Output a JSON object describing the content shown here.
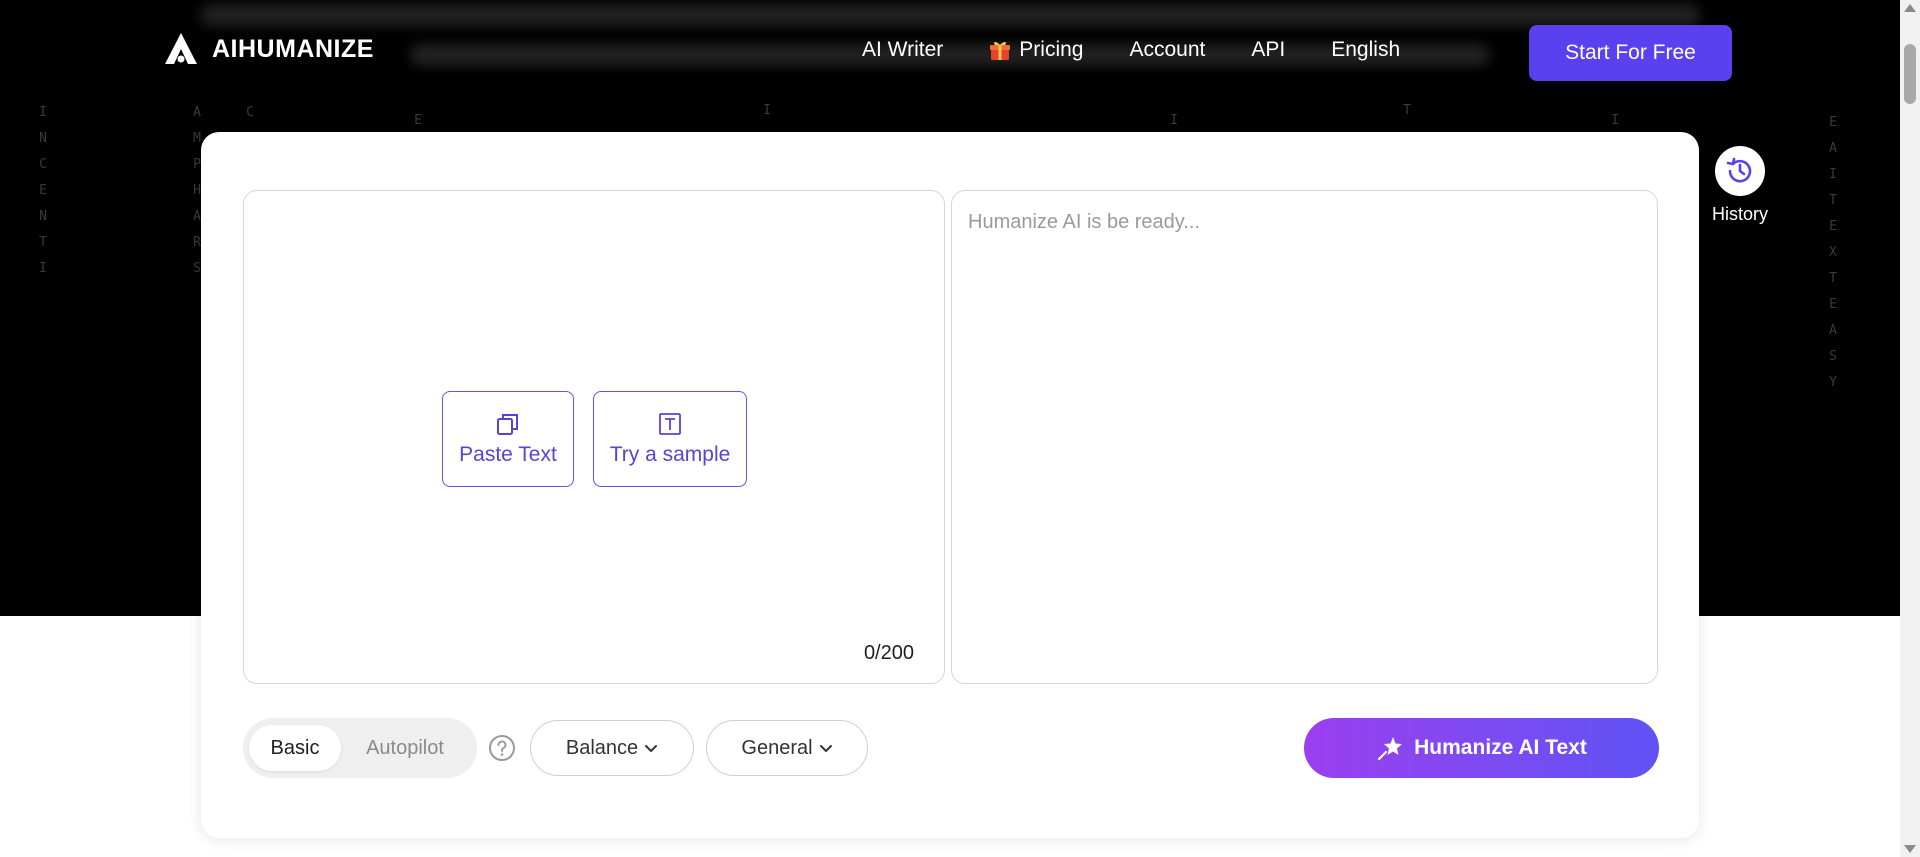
{
  "brand": {
    "name": "AIHUMANIZE",
    "accent": "#5a41f0",
    "background": "#000000"
  },
  "nav": {
    "items": [
      {
        "label": "AI Writer",
        "icon": ""
      },
      {
        "label": "Pricing",
        "icon": "gift-icon"
      },
      {
        "label": "Account",
        "icon": ""
      },
      {
        "label": "API",
        "icon": ""
      },
      {
        "label": "English",
        "icon": ""
      }
    ],
    "cta": "Start For Free"
  },
  "history": {
    "label": "History",
    "icon": "history-icon"
  },
  "editor": {
    "paste_label": "Paste Text",
    "sample_label": "Try a sample",
    "counter": "0/200",
    "output_placeholder": "Humanize AI is be ready..."
  },
  "controls": {
    "modes": [
      "Basic",
      "Autopilot"
    ],
    "active_mode": "Basic",
    "balance": "Balance",
    "general": "General",
    "submit": "Humanize AI Text",
    "submit_gradient": [
      "#9a3ef0",
      "#5f52f4"
    ]
  }
}
